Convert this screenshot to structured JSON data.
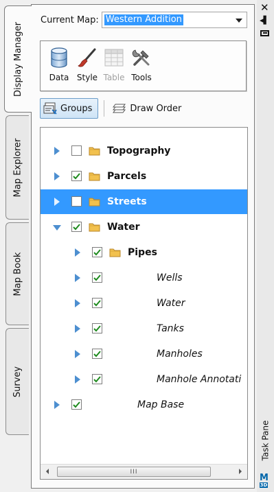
{
  "side_tabs": [
    {
      "label": "Display Manager",
      "active": true
    },
    {
      "label": "Map Explorer",
      "active": false
    },
    {
      "label": "Map Book",
      "active": false
    },
    {
      "label": "Survey",
      "active": false
    }
  ],
  "header": {
    "current_map_label": "Current Map:",
    "current_map_value": "Western Addition"
  },
  "ribbon": {
    "buttons": [
      {
        "label": "Data",
        "icon": "data-cylinder-icon",
        "enabled": true
      },
      {
        "label": "Style",
        "icon": "paintbrush-icon",
        "enabled": true
      },
      {
        "label": "Table",
        "icon": "table-grid-icon",
        "enabled": false
      },
      {
        "label": "Tools",
        "icon": "tools-hammer-wrench-icon",
        "enabled": true
      }
    ]
  },
  "toolbar": {
    "groups_label": "Groups",
    "draw_order_label": "Draw Order"
  },
  "tree": {
    "items": [
      {
        "label": "Topography",
        "level": 0,
        "expanded": false,
        "checked": false,
        "folder": true,
        "bold": true,
        "italic": false,
        "selected": false
      },
      {
        "label": "Parcels",
        "level": 0,
        "expanded": false,
        "checked": true,
        "folder": true,
        "bold": true,
        "italic": false,
        "selected": false
      },
      {
        "label": "Streets",
        "level": 0,
        "expanded": false,
        "checked": false,
        "folder": true,
        "bold": true,
        "italic": false,
        "selected": true
      },
      {
        "label": "Water",
        "level": 0,
        "expanded": true,
        "checked": true,
        "folder": true,
        "bold": true,
        "italic": false,
        "selected": false
      },
      {
        "label": "Pipes",
        "level": 1,
        "expanded": false,
        "checked": true,
        "folder": true,
        "bold": true,
        "italic": false,
        "selected": false
      },
      {
        "label": "Wells",
        "level": 1,
        "expanded": false,
        "checked": true,
        "folder": false,
        "bold": false,
        "italic": true,
        "selected": false
      },
      {
        "label": "Water",
        "level": 1,
        "expanded": false,
        "checked": true,
        "folder": false,
        "bold": false,
        "italic": true,
        "selected": false
      },
      {
        "label": "Tanks",
        "level": 1,
        "expanded": false,
        "checked": true,
        "folder": false,
        "bold": false,
        "italic": true,
        "selected": false
      },
      {
        "label": "Manholes",
        "level": 1,
        "expanded": false,
        "checked": true,
        "folder": false,
        "bold": false,
        "italic": true,
        "selected": false
      },
      {
        "label": "Manhole Annotati",
        "level": 1,
        "expanded": false,
        "checked": true,
        "folder": false,
        "bold": false,
        "italic": true,
        "selected": false
      },
      {
        "label": "Map Base",
        "level": 0,
        "expanded": false,
        "checked": true,
        "folder": false,
        "bold": false,
        "italic": true,
        "selected": false
      }
    ]
  },
  "scrollbar": {
    "grip": "III"
  },
  "right_strip": {
    "close_icon": "close-icon",
    "pin_icon": "auto-hide-icon",
    "properties_icon": "properties-icon",
    "task_pane_label": "Task Pane",
    "logo_text": "M",
    "logo_sub": "3D"
  },
  "colors": {
    "selection": "#3399ff",
    "twisty": "#4d8fd0",
    "folder": "#f2c14e",
    "check": "#1e8a1e"
  }
}
